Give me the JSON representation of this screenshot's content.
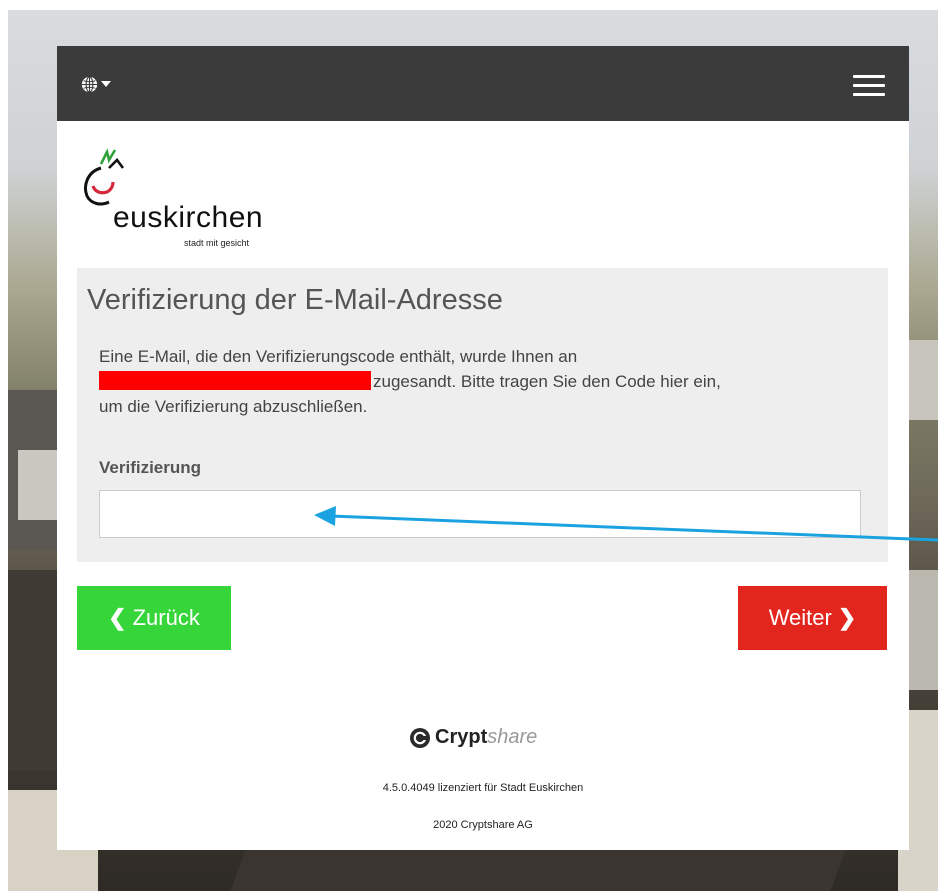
{
  "topbar": {
    "language_icon": "globe-icon",
    "dropdown_icon": "caret-down-icon",
    "menu_icon": "hamburger-menu-icon"
  },
  "logo": {
    "name": "euskirchen",
    "tagline": "stadt mit gesicht"
  },
  "panel": {
    "title": "Verifizierung der E-Mail-Adresse",
    "text_line1": "Eine E-Mail, die den Verifizierungscode enthält, wurde Ihnen an",
    "text_line2": "zugesandt. Bitte tragen Sie den Code hier ein,",
    "text_line3": "um die Verifizierung abzuschließen.",
    "field_label": "Verifizierung",
    "field_value": ""
  },
  "buttons": {
    "back_label": "Zurück",
    "next_label": "Weiter",
    "back_color": "#36d63a",
    "next_color": "#e3261d"
  },
  "footer": {
    "brand_bold": "Crypt",
    "brand_light": "share",
    "license": "4.5.0.4049 lizenziert für Stadt Euskirchen",
    "copyright": "2020 Cryptshare AG"
  },
  "colors": {
    "topbar": "#3b3b3b",
    "panel": "#eeeeee",
    "redaction": "#ff0000",
    "annotation_arrow": "#1aa3e0"
  }
}
